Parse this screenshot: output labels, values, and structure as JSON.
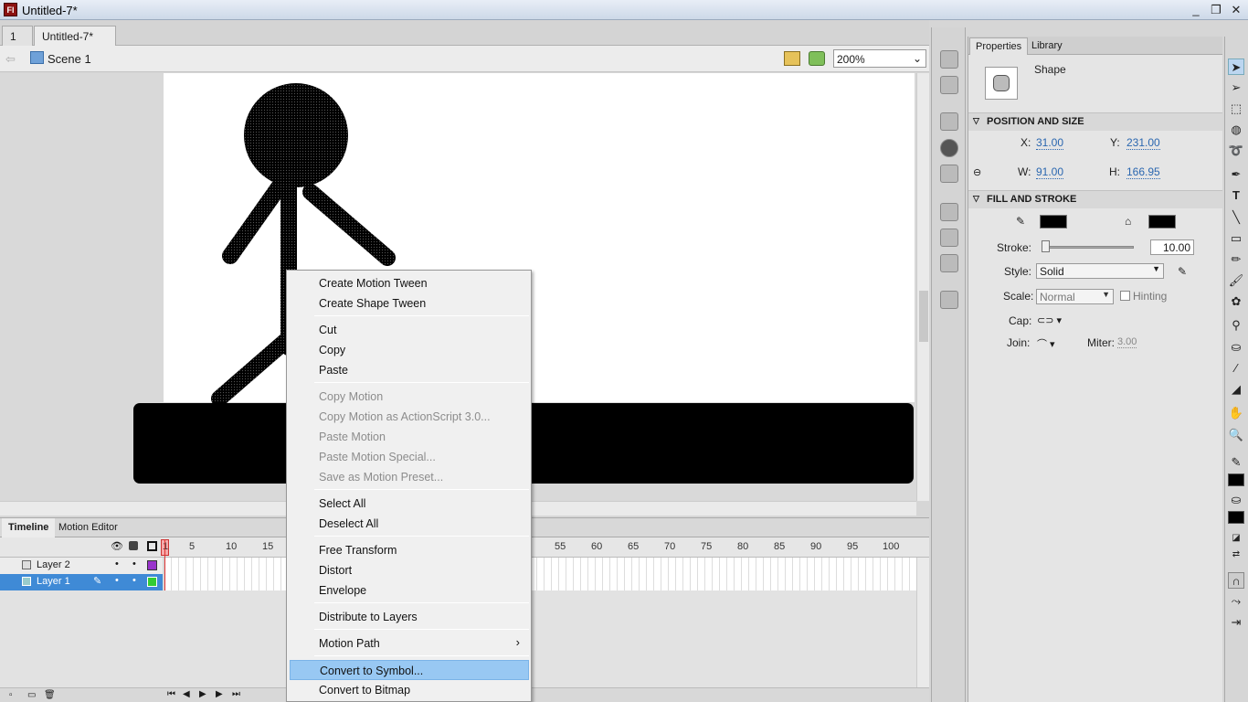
{
  "window": {
    "title": "Untitled-7*",
    "app_icon": "Fl",
    "minimize": "_",
    "maximize": "❐",
    "close": "✕"
  },
  "doc_tabs": [
    {
      "label": "1",
      "close": "×"
    },
    {
      "label": "Untitled-7*",
      "close": "×"
    }
  ],
  "editbar": {
    "scene_label": "Scene 1",
    "zoom_value": "200%"
  },
  "timeline": {
    "tabs": [
      "Timeline",
      "Motion Editor"
    ],
    "frame_numbers": [
      "1",
      "5",
      "10",
      "15",
      "55",
      "60",
      "65",
      "70",
      "75",
      "80",
      "85",
      "90",
      "95",
      "100"
    ],
    "layers": [
      {
        "name": "Layer 2",
        "color": "#9933cc",
        "selected": false
      },
      {
        "name": "Layer 1",
        "color": "#33cc33",
        "selected": true
      }
    ],
    "current_frame": 1
  },
  "properties": {
    "tabs": [
      "Properties",
      "Library"
    ],
    "object_type": "Shape",
    "position_section": "POSITION AND SIZE",
    "x_label": "X:",
    "x": "31.00",
    "y_label": "Y:",
    "y": "231.00",
    "w_label": "W:",
    "w": "91.00",
    "h_label": "H:",
    "h": "166.95",
    "fill_section": "FILL AND STROKE",
    "stroke_label": "Stroke:",
    "stroke_value": "10.00",
    "style_label": "Style:",
    "style_value": "Solid",
    "scale_label": "Scale:",
    "scale_value": "Normal",
    "hinting_label": "Hinting",
    "cap_label": "Cap:",
    "join_label": "Join:",
    "miter_label": "Miter:",
    "miter_value": "3.00",
    "stroke_color": "#000000",
    "fill_color": "#000000"
  },
  "context_menu": {
    "items": [
      {
        "label": "Create Motion Tween",
        "enabled": true
      },
      {
        "label": "Create Shape Tween",
        "enabled": true
      },
      {
        "label": "Cut",
        "enabled": true
      },
      {
        "label": "Copy",
        "enabled": true
      },
      {
        "label": "Paste",
        "enabled": true
      },
      {
        "label": "Copy Motion",
        "enabled": false
      },
      {
        "label": "Copy Motion as ActionScript 3.0...",
        "enabled": false
      },
      {
        "label": "Paste Motion",
        "enabled": false
      },
      {
        "label": "Paste Motion Special...",
        "enabled": false
      },
      {
        "label": "Save as Motion Preset...",
        "enabled": false
      },
      {
        "label": "Select All",
        "enabled": true
      },
      {
        "label": "Deselect All",
        "enabled": true
      },
      {
        "label": "Free Transform",
        "enabled": true
      },
      {
        "label": "Distort",
        "enabled": true
      },
      {
        "label": "Envelope",
        "enabled": true
      },
      {
        "label": "Distribute to Layers",
        "enabled": true
      },
      {
        "label": "Motion Path",
        "enabled": true,
        "submenu_arrow": "›"
      },
      {
        "label": "Convert to Symbol...",
        "enabled": true,
        "highlighted": true
      },
      {
        "label": "Convert to Bitmap",
        "enabled": true
      }
    ]
  },
  "icons": [
    "flash-app-icon",
    "back-arrow-icon",
    "scene-icon",
    "edit-scene-icon",
    "edit-symbol-icon",
    "zoom-dropdown-icon",
    "selection-tool-icon",
    "subselection-tool-icon",
    "free-transform-icon",
    "3d-rotation-icon",
    "lasso-icon",
    "pen-icon",
    "text-icon",
    "line-icon",
    "rectangle-icon",
    "pencil-icon",
    "brush-icon",
    "deco-icon",
    "bone-icon",
    "paint-bucket-icon",
    "eyedropper-icon",
    "eraser-icon",
    "hand-icon",
    "zoom-icon",
    "eye-icon",
    "lock-icon",
    "outline-icon"
  ]
}
